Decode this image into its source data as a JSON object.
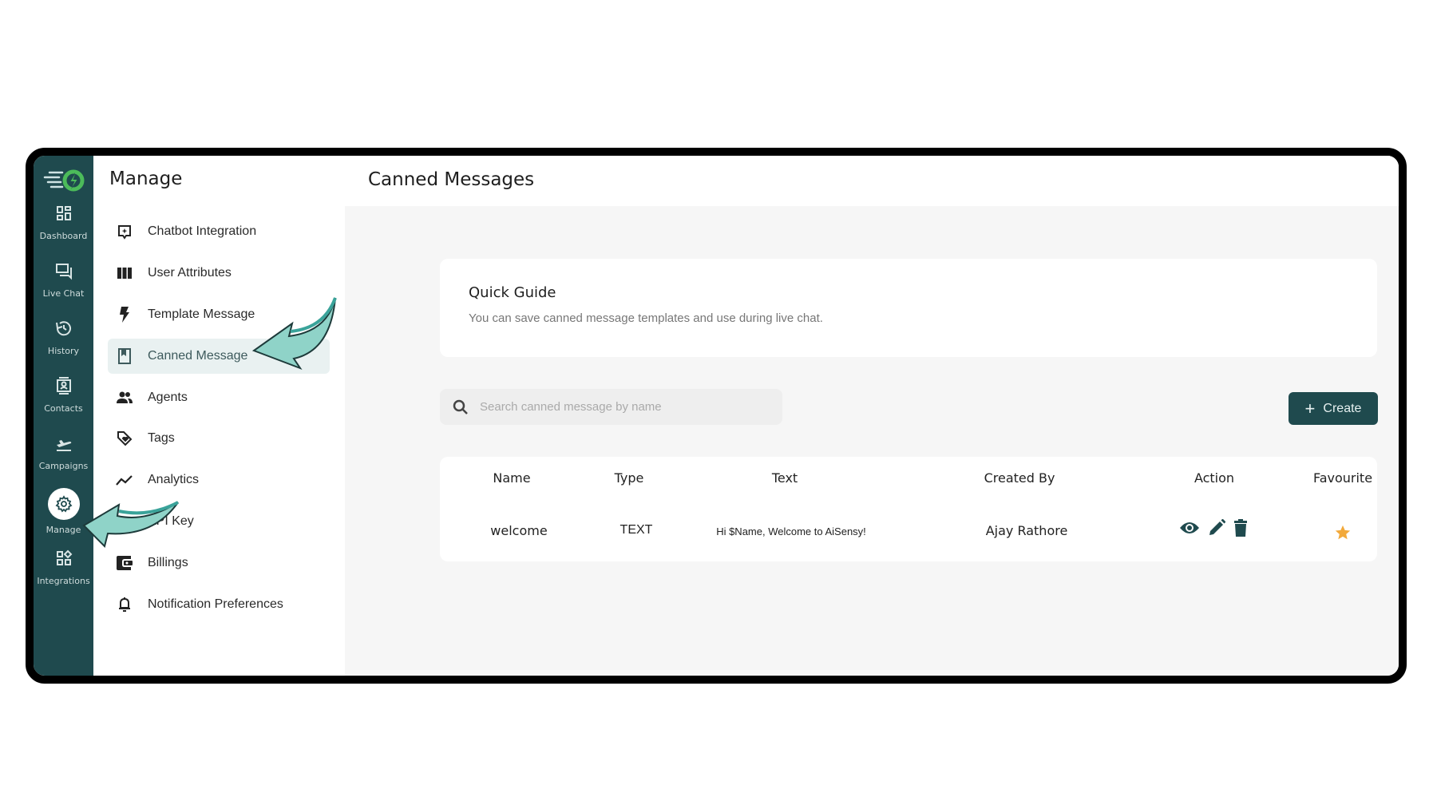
{
  "app": {
    "logo": "aisensy-logo",
    "accent_color": "#1f4a4e",
    "highlight_color": "#e9f1f1",
    "star_color": "#f2a93b"
  },
  "rail": {
    "items": [
      {
        "label": "Dashboard",
        "icon": "dashboard-icon"
      },
      {
        "label": "Live Chat",
        "icon": "chat-icon"
      },
      {
        "label": "History",
        "icon": "history-icon"
      },
      {
        "label": "Contacts",
        "icon": "contacts-icon"
      },
      {
        "label": "Campaigns",
        "icon": "campaigns-icon"
      },
      {
        "label": "Manage",
        "icon": "gear-icon",
        "active": true
      },
      {
        "label": "Integrations",
        "icon": "integrations-icon"
      }
    ]
  },
  "panel": {
    "title": "Manage",
    "items": [
      {
        "label": "Chatbot Integration",
        "icon": "chatbot-icon"
      },
      {
        "label": "User Attributes",
        "icon": "columns-icon"
      },
      {
        "label": "Template Message",
        "icon": "bolt-icon"
      },
      {
        "label": "Canned Message",
        "icon": "bookmark-icon",
        "active": true
      },
      {
        "label": "Agents",
        "icon": "agents-icon"
      },
      {
        "label": "Tags",
        "icon": "tag-icon"
      },
      {
        "label": "Analytics",
        "icon": "analytics-icon"
      },
      {
        "label": "API Key",
        "icon": "key-icon"
      },
      {
        "label": "Billings",
        "icon": "wallet-icon"
      },
      {
        "label": "Notification Preferences",
        "icon": "bell-icon"
      }
    ]
  },
  "main": {
    "title": "Canned Messages",
    "guide": {
      "title": "Quick Guide",
      "description": "You can save canned message templates and use during live chat."
    },
    "search": {
      "placeholder": "Search canned message by name",
      "value": ""
    },
    "create_label": "Create",
    "table": {
      "columns": [
        "Name",
        "Type",
        "Text",
        "Created By",
        "Action",
        "Favourite"
      ],
      "rows": [
        {
          "name": "welcome",
          "type": "TEXT",
          "text": "Hi $Name, Welcome to AiSensy!",
          "created_by": "Ajay Rathore",
          "actions": [
            "view",
            "edit",
            "delete"
          ],
          "favourite": true
        }
      ]
    }
  }
}
